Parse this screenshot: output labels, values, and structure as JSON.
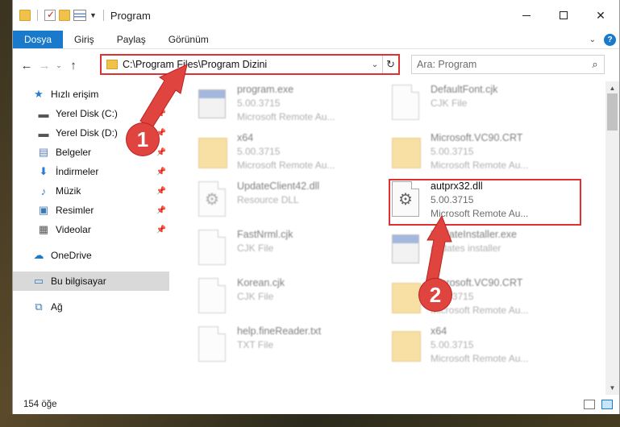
{
  "window": {
    "title": "Program"
  },
  "ribbon": {
    "tabs": [
      "Dosya",
      "Giriş",
      "Paylaş",
      "Görünüm"
    ],
    "help": "?"
  },
  "address": {
    "path": "C:\\Program Files\\Program Dizini"
  },
  "search": {
    "placeholder": "Ara: Program"
  },
  "sidebar": {
    "quick_access": "Hızlı erişim",
    "items": [
      "Yerel Disk (C:)",
      "Yerel Disk (D:)",
      "Belgeler",
      "İndirmeler",
      "Müzik",
      "Resimler",
      "Videolar"
    ],
    "onedrive": "OneDrive",
    "this_pc": "Bu bilgisayar",
    "network": "Ağ"
  },
  "files": [
    {
      "name": "program.exe",
      "line2": "5.00.3715",
      "line3": "Microsoft Remote Au...",
      "icon": "exe-icon"
    },
    {
      "name": "DefaultFont.cjk",
      "line2": "CJK File",
      "line3": "",
      "icon": "document-icon"
    },
    {
      "name": "x64",
      "line2": "5.00.3715",
      "line3": "Microsoft Remote Au...",
      "icon": "folder-icon"
    },
    {
      "name": "Microsoft.VC90.CRT",
      "line2": "5.00.3715",
      "line3": "Microsoft Remote Au...",
      "icon": "folder-icon"
    },
    {
      "name": "UpdateClient42.dll",
      "line2": "Resource DLL",
      "line3": "",
      "icon": "dll-icon"
    },
    {
      "name": "autprx32.dll",
      "line2": "5.00.3715",
      "line3": "Microsoft Remote Au...",
      "icon": "dll-icon"
    },
    {
      "name": "FastNrml.cjk",
      "line2": "CJK File",
      "line3": "",
      "icon": "document-icon"
    },
    {
      "name": "UpdateInstaller.exe",
      "line2": "",
      "line3": "updates installer",
      "icon": "installer-icon"
    },
    {
      "name": "Korean.cjk",
      "line2": "CJK File",
      "line3": "",
      "icon": "document-icon"
    },
    {
      "name": "Microsoft.VC90.CRT",
      "line2": "5.00.3715",
      "line3": "Microsoft Remote Au...",
      "icon": "folder-icon"
    },
    {
      "name": "help.fineReader.txt",
      "line2": "TXT File",
      "line3": "",
      "icon": "text-file-icon"
    },
    {
      "name": "x64",
      "line2": "5.00.3715",
      "line3": "Microsoft Remote Au...",
      "icon": "folder-icon"
    }
  ],
  "status": {
    "item_count": "154 öğe"
  },
  "annotations": {
    "step1": "1",
    "step2": "2",
    "color": "#e0443f"
  }
}
